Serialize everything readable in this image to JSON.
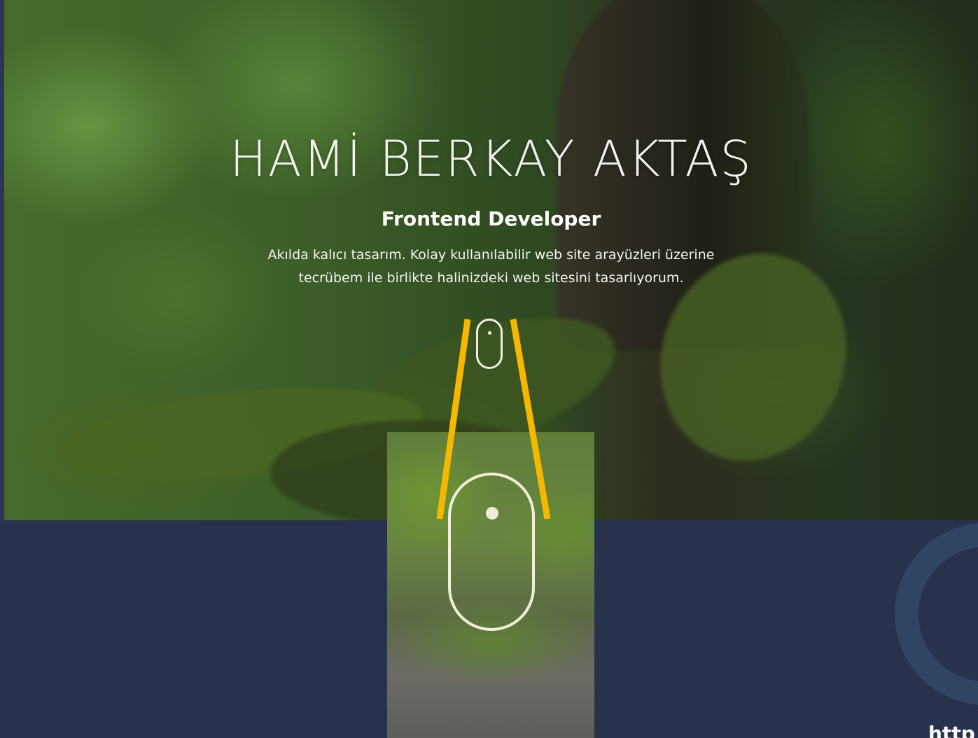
{
  "hero": {
    "title": "HAMİ BERKAY AKTAŞ",
    "subtitle": "Frontend Developer",
    "description_line1": "Akılda kalıcı tasarım. Kolay kullanılabilir web site arayüzleri üzerine",
    "description_line2": "tecrübem ile birlikte halinizdeki web sitesini tasarlıyorum."
  },
  "icons": {
    "scroll_indicator": "mouse-scroll-icon",
    "zoom_callout": "mouse-scroll-icon-enlarged"
  },
  "colors": {
    "page_background": "#28324d",
    "hero_text": "#ffffff",
    "callout_lines": "#f5b800",
    "decorative_ring": "#2f4563"
  },
  "footer": {
    "corner_text": "http"
  }
}
